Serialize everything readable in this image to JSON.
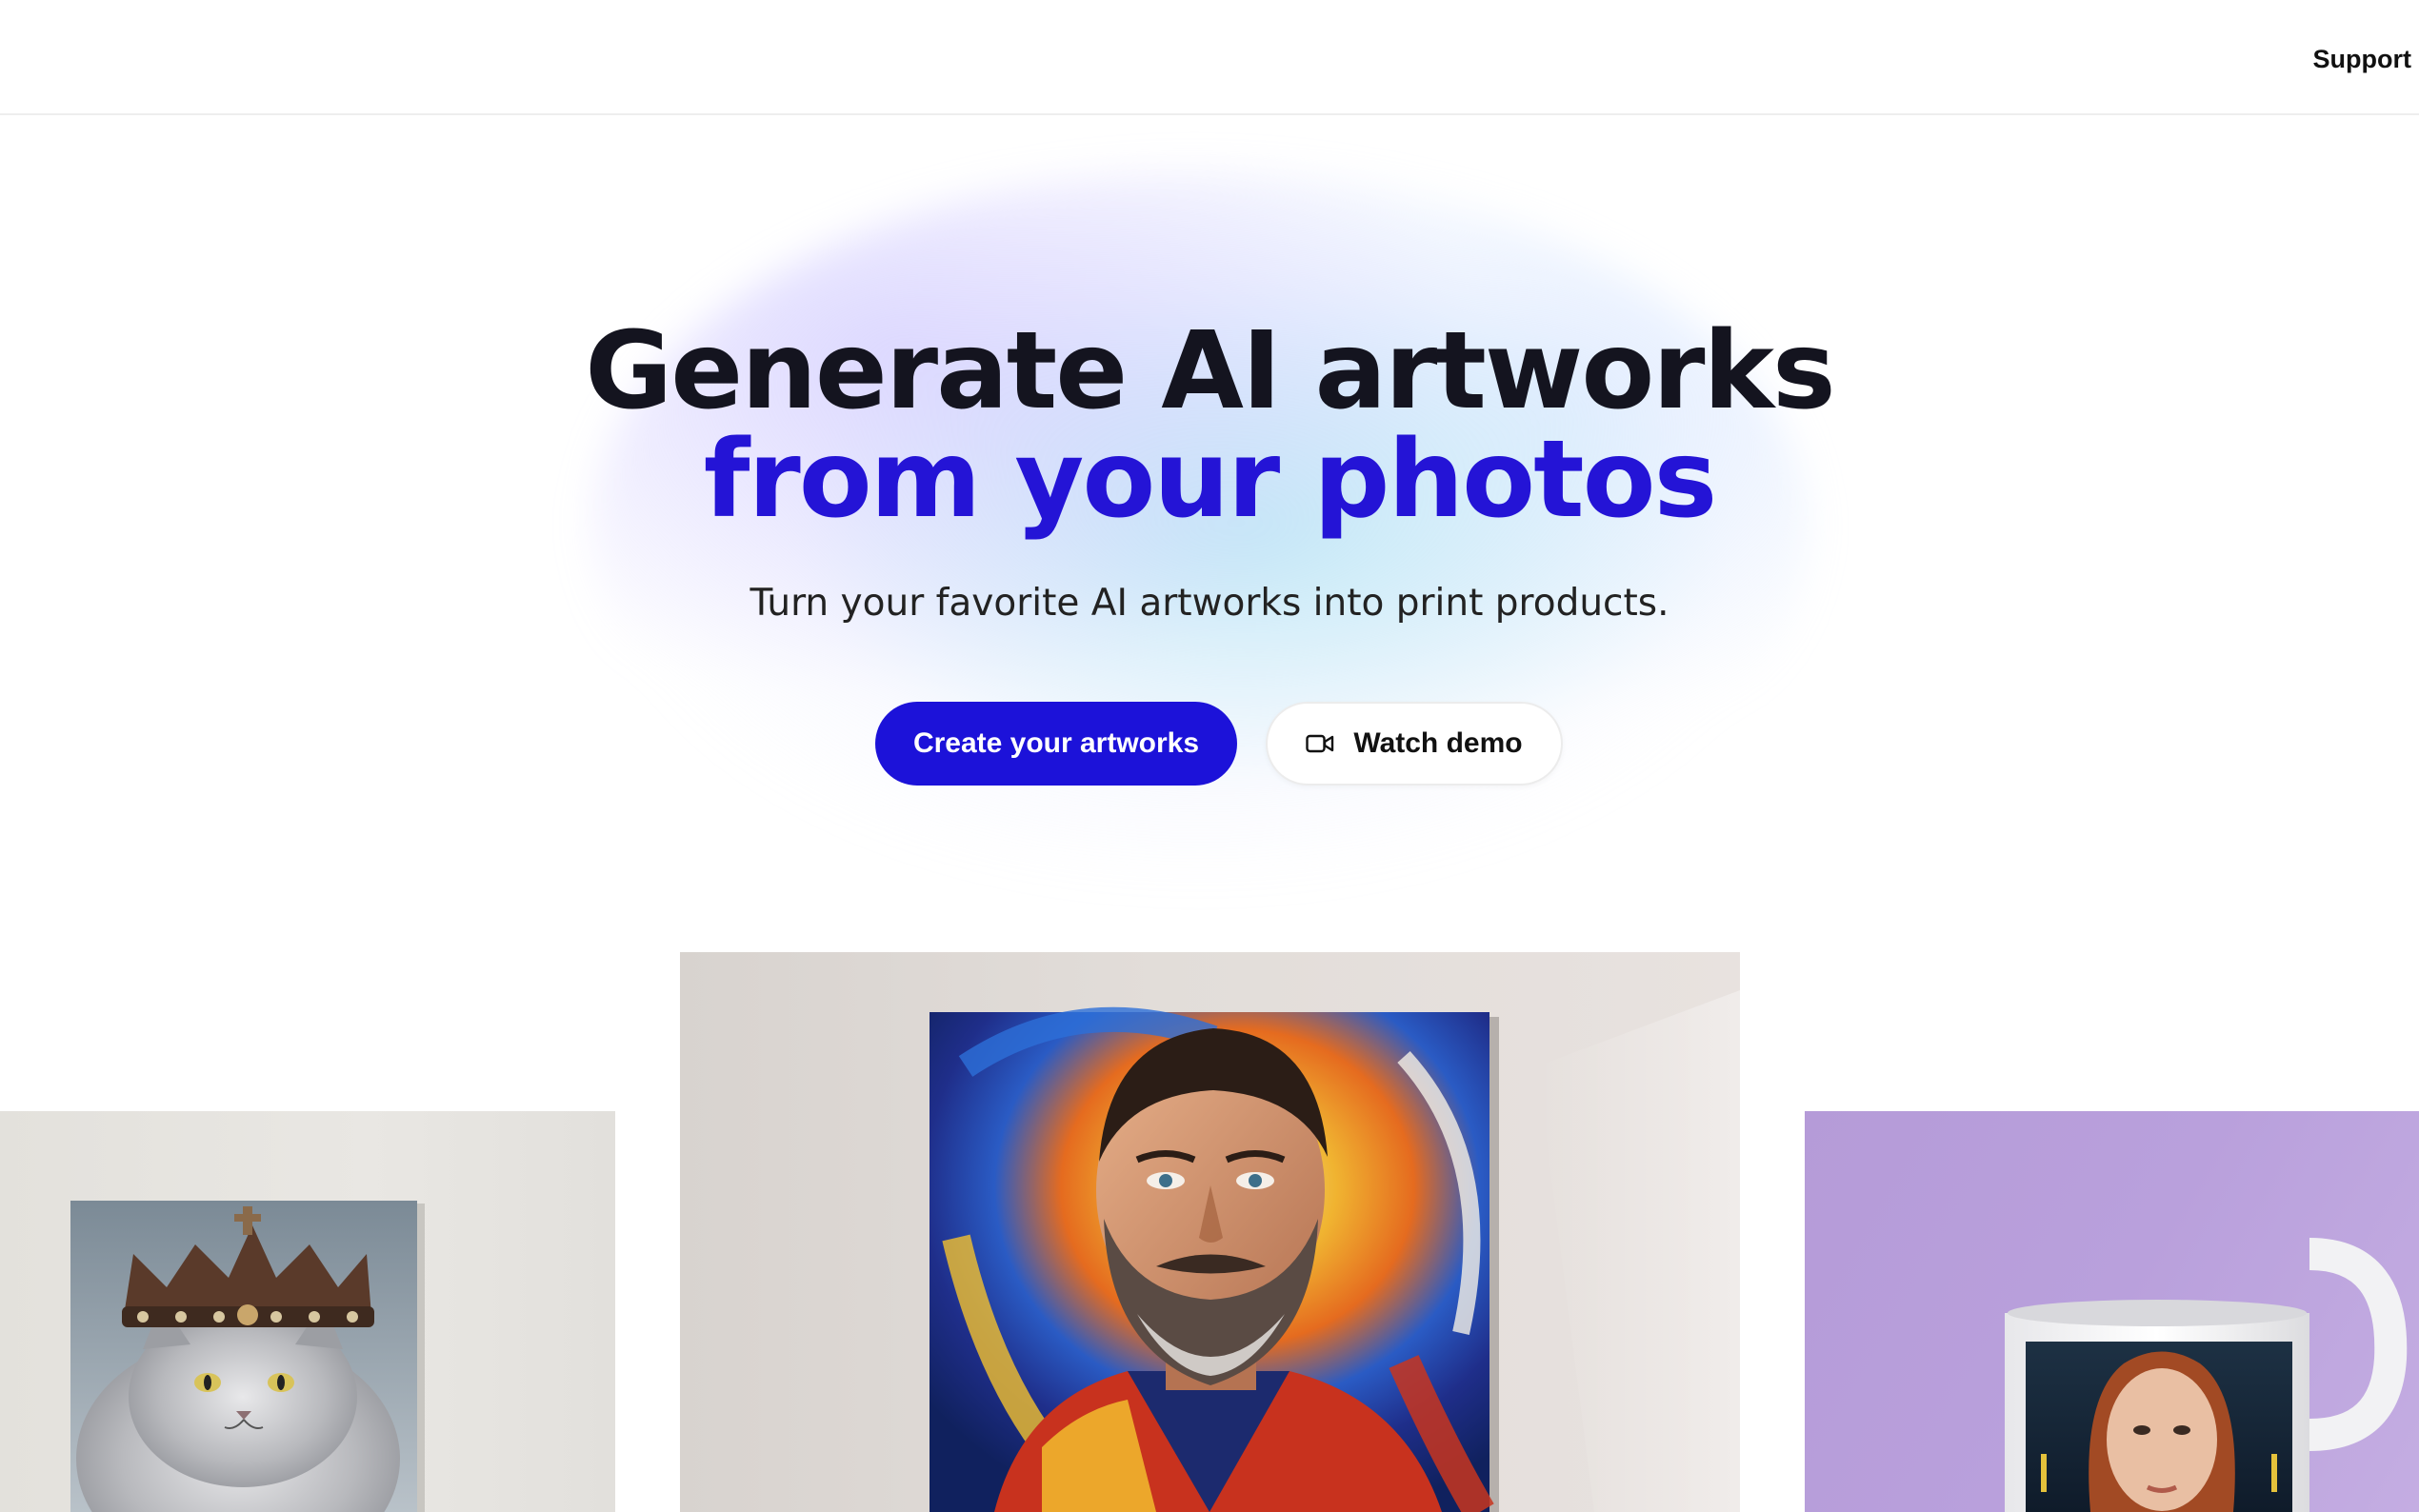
{
  "header": {
    "support_label": "Support"
  },
  "hero": {
    "headline_line1": "Generate AI artworks",
    "headline_line2": "from your photos",
    "subtitle": "Turn your favorite AI artworks into print products.",
    "primary_cta": "Create your artworks",
    "secondary_cta": "Watch demo",
    "secondary_cta_icon": "video-camera-icon"
  },
  "gallery": {
    "items": [
      {
        "name": "cat-crown-canvas",
        "icon": "image"
      },
      {
        "name": "bearded-man-portrait-canvas",
        "icon": "image"
      },
      {
        "name": "woman-portrait-mug",
        "icon": "image"
      }
    ]
  },
  "colors": {
    "accent": "#1c12d9",
    "headline": "#14141f",
    "headline_accent": "#2414d6"
  }
}
